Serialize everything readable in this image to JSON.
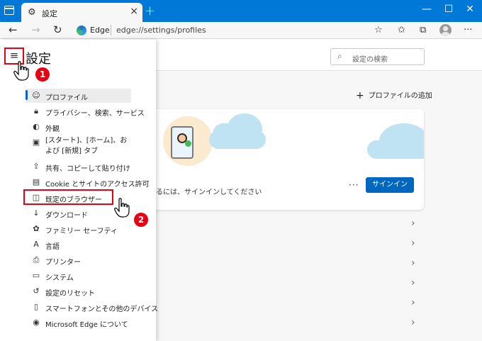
{
  "browser": {
    "tab_title": "設定",
    "url_brand": "Edge",
    "url": "edge://settings/profiles"
  },
  "sidebar": {
    "title": "設定",
    "items": [
      {
        "label": "プロファイル",
        "icon": "profile-icon"
      },
      {
        "label": "プライバシー、検索、サービス",
        "icon": "lock-icon"
      },
      {
        "label": "外観",
        "icon": "appearance-icon"
      },
      {
        "label": "[スタート]、[ホーム]、および [新規] タブ",
        "icon": "start-page-icon"
      },
      {
        "label": "共有、コピーして貼り付け",
        "icon": "share-icon"
      },
      {
        "label": "Cookie とサイトのアクセス許可",
        "icon": "cookie-icon"
      },
      {
        "label": "既定のブラウザー",
        "icon": "default-browser-icon"
      },
      {
        "label": "ダウンロード",
        "icon": "download-icon"
      },
      {
        "label": "ファミリー セーフティ",
        "icon": "family-icon"
      },
      {
        "label": "言語",
        "icon": "language-icon"
      },
      {
        "label": "プリンター",
        "icon": "printer-icon"
      },
      {
        "label": "システム",
        "icon": "system-icon"
      },
      {
        "label": "設定のリセット",
        "icon": "reset-icon"
      },
      {
        "label": "スマートフォンとその他のデバイス",
        "icon": "phone-icon"
      },
      {
        "label": "Microsoft Edge について",
        "icon": "edge-icon"
      }
    ]
  },
  "search": {
    "placeholder": "設定の検索"
  },
  "profile": {
    "add_label": "プロファイルの追加",
    "signin_text": "るには、サインインしてください",
    "signin_button": "サインイン",
    "more_label": "···"
  },
  "annotations": {
    "step1": "1",
    "step2": "2"
  },
  "colors": {
    "titlebar": "#0078d7",
    "accent": "#0067c0",
    "highlight": "#e60012"
  }
}
